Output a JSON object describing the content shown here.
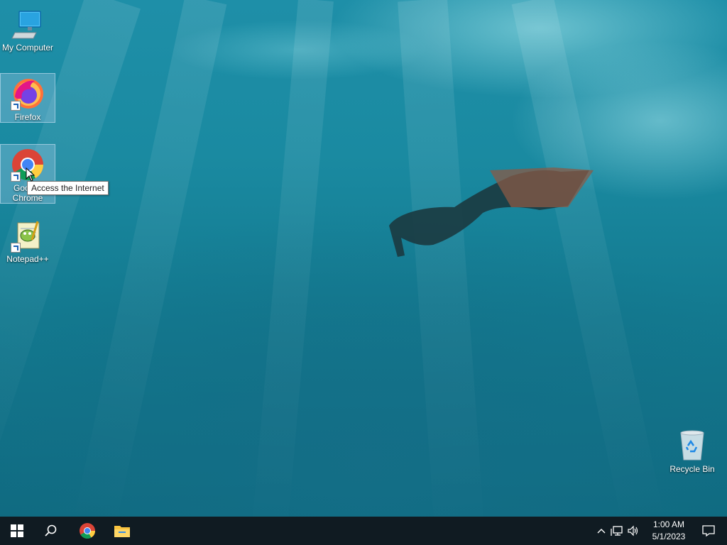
{
  "desktop": {
    "icons": [
      {
        "label": "My Computer",
        "icon": "computer-icon"
      },
      {
        "label": "Firefox",
        "icon": "firefox-icon"
      },
      {
        "label": "Google Chrome",
        "icon": "chrome-icon"
      },
      {
        "label": "Notepad++",
        "icon": "notepadpp-icon"
      },
      {
        "label": "Recycle Bin",
        "icon": "recycle-bin-icon"
      }
    ],
    "chrome_label_line1": "Goo",
    "chrome_label_line2": "Chrome"
  },
  "tooltip": {
    "text": "Access the Internet"
  },
  "taskbar": {
    "start": "windows-start-icon",
    "search": "search-icon",
    "pinned": [
      "chrome-icon",
      "file-explorer-icon"
    ],
    "tray": {
      "icons": [
        "chevron-up-icon",
        "network-icon",
        "volume-icon",
        "notification-icon"
      ],
      "time": "1:00 AM",
      "date": "5/1/2023"
    }
  }
}
